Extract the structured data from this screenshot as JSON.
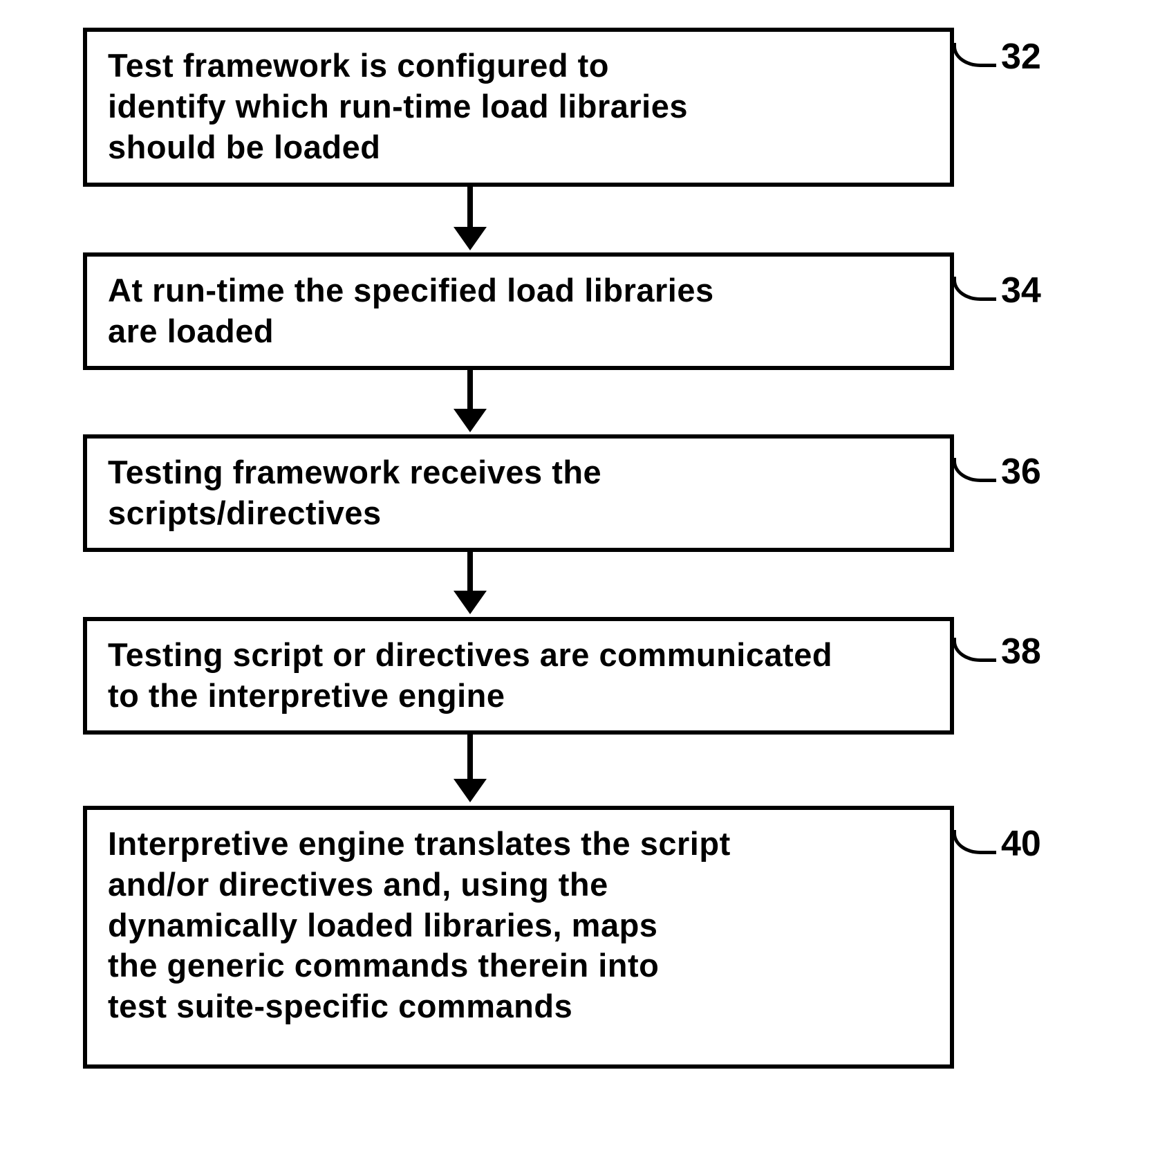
{
  "boxes": [
    {
      "id": "32",
      "text": "Test framework is configured to\nidentify which run-time load libraries\nshould be loaded"
    },
    {
      "id": "34",
      "text": "At run-time the specified load libraries\nare loaded"
    },
    {
      "id": "36",
      "text": "Testing framework receives the\nscripts/directives"
    },
    {
      "id": "38",
      "text": "Testing script or directives are communicated\nto the interpretive engine"
    },
    {
      "id": "40",
      "text": "Interpretive engine translates the script\nand/or directives and, using the\ndynamically loaded libraries, maps\nthe generic commands therein into\ntest suite-specific commands"
    }
  ]
}
